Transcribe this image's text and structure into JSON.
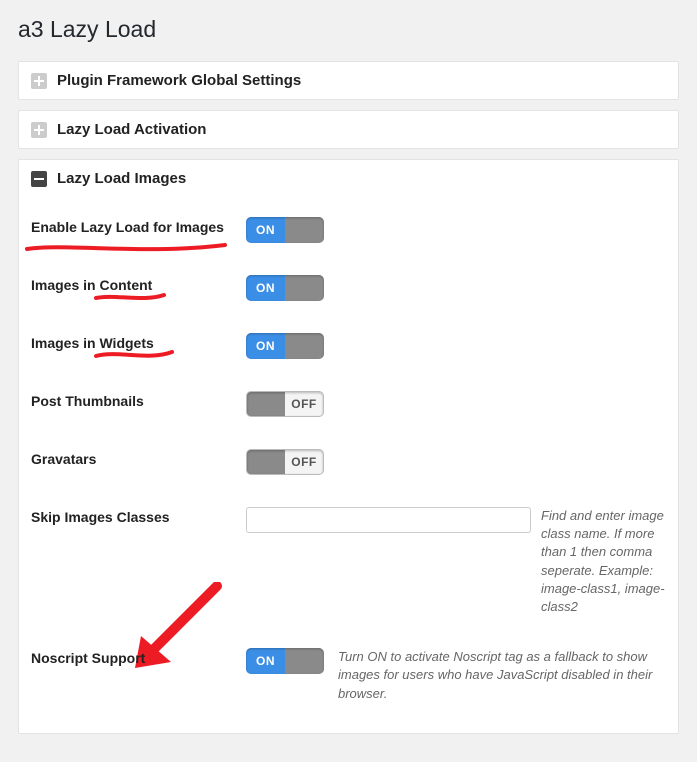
{
  "page_title": "a3 Lazy Load",
  "panels": {
    "framework": {
      "title": "Plugin Framework Global Settings"
    },
    "activation": {
      "title": "Lazy Load Activation"
    },
    "images": {
      "title": "Lazy Load Images"
    }
  },
  "toggle": {
    "on": "ON",
    "off": "OFF"
  },
  "rows": {
    "enable": {
      "label": "Enable Lazy Load for Images",
      "value": "ON"
    },
    "content": {
      "label": "Images in Content",
      "value": "ON"
    },
    "widgets": {
      "label": "Images in Widgets",
      "value": "ON"
    },
    "thumbnails": {
      "label": "Post Thumbnails",
      "value": "OFF"
    },
    "gravatars": {
      "label": "Gravatars",
      "value": "OFF"
    },
    "skip": {
      "label": "Skip Images Classes",
      "input_value": "",
      "desc": "Find and enter image class name. If more than 1 then comma seperate. Example: image-class1, image-class2"
    },
    "noscript": {
      "label": "Noscript Support",
      "value": "ON",
      "desc": "Turn ON to activate Noscript tag as a fallback to show images for users who have JavaScript disabled in their browser."
    }
  }
}
